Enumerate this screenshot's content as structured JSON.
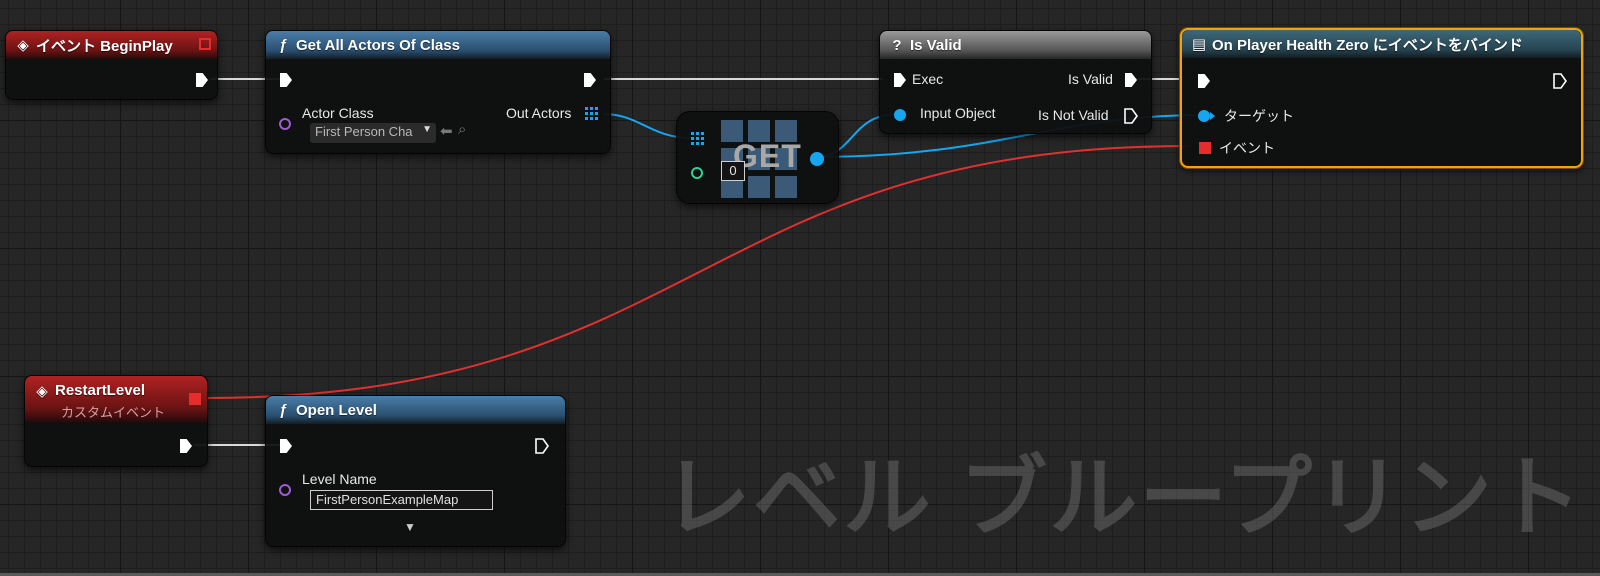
{
  "nodes": {
    "begin_play": {
      "title": "イベント BeginPlay"
    },
    "get_all_actors": {
      "title": "Get All Actors Of Class",
      "actor_class_label": "Actor Class",
      "actor_class_value": "First Person Cha",
      "out_actors_label": "Out Actors"
    },
    "get": {
      "title": "GET",
      "index_value": "0"
    },
    "is_valid": {
      "title": "Is Valid",
      "exec_label": "Exec",
      "input_object_label": "Input Object",
      "is_valid_label": "Is Valid",
      "is_not_valid_label": "Is Not Valid"
    },
    "bind_event": {
      "title": "On Player Health Zero にイベントをバインド",
      "target_label": "ターゲット",
      "event_label": "イベント"
    },
    "restart_level": {
      "title": "RestartLevel",
      "subtitle": "カスタムイベント"
    },
    "open_level": {
      "title": "Open Level",
      "level_name_label": "Level Name",
      "level_name_value": "FirstPersonExampleMap"
    }
  },
  "watermark": "レベル ブループリント",
  "colors": {
    "exec_wire": "#d9d9d9",
    "object_wire": "#16a6f0",
    "delegate_wire": "#e03030",
    "selected_outline": "#f5a10a"
  }
}
